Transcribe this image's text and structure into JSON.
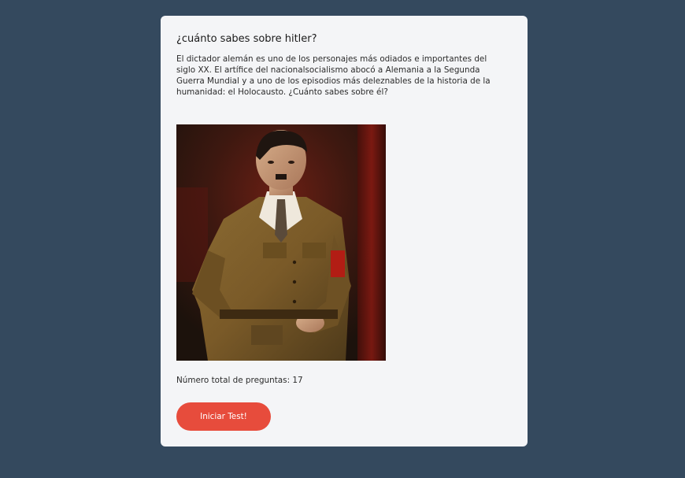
{
  "quiz": {
    "title": "¿cuánto sabes sobre hitler?",
    "description": "El dictador alemán es uno de los personajes más odiados e importantes del siglo XX. El artífice del nacionalsocialismo abocó a Alemania a la Segunda Guerra Mundial y a uno de los episodios más deleznables de la historia de la humanidad: el Holocausto. ¿Cuánto sabes sobre él?",
    "total_questions_label": "Número total de preguntas: 17",
    "start_button_label": "Iniciar Test!"
  },
  "colors": {
    "background": "#34495e",
    "card": "#f4f5f7",
    "accent": "#e74c3c"
  }
}
